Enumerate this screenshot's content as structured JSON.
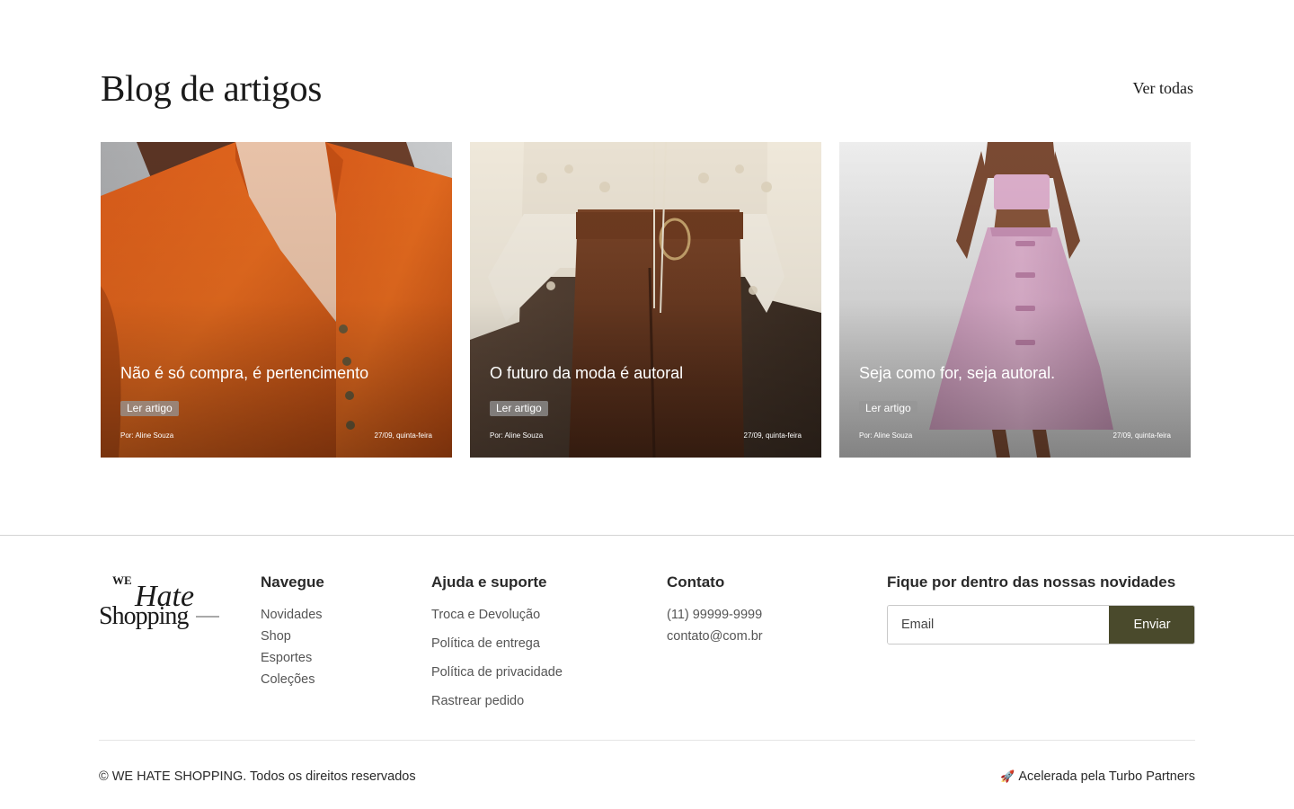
{
  "blog": {
    "title": "Blog de artigos",
    "view_all": "Ver todas",
    "cards": [
      {
        "title": "Não é só compra, é pertencimento",
        "button": "Ler artigo",
        "author": "Por: Aline Souza",
        "date": "27/09, quinta-feira"
      },
      {
        "title": "O futuro da moda é autoral",
        "button": "Ler artigo",
        "author": "Por: Aline Souza",
        "date": "27/09, quinta-feira"
      },
      {
        "title": "Seja como for, seja autoral.",
        "button": "Ler artigo",
        "author": "Por: Aline Souza",
        "date": "27/09, quinta-feira"
      }
    ]
  },
  "footer": {
    "logo": {
      "line1": "WE",
      "line2": "Hate",
      "line3": "Shopping"
    },
    "nav": {
      "heading": "Navegue",
      "items": [
        "Novidades",
        "Shop",
        "Esportes",
        "Coleções"
      ]
    },
    "help": {
      "heading": "Ajuda e suporte",
      "items": [
        "Troca e Devolução",
        "Política de entrega",
        "Política de privacidade",
        "Rastrear pedido"
      ]
    },
    "contact": {
      "heading": "Contato",
      "phone": "(11) 99999-9999",
      "email": "contato@com.br"
    },
    "newsletter": {
      "heading": "Fique por dentro das nossas novidades",
      "placeholder": "Email",
      "button": "Enviar"
    },
    "copyright": "© WE HATE SHOPPING. Todos os direitos reservados",
    "credit": "Acelerada pela Turbo Partners",
    "credit_icon": "rocket-icon"
  },
  "colors": {
    "button_dark_olive": "#4a4a2c",
    "divider": "#d4d4d4",
    "link_gray": "#555555"
  }
}
